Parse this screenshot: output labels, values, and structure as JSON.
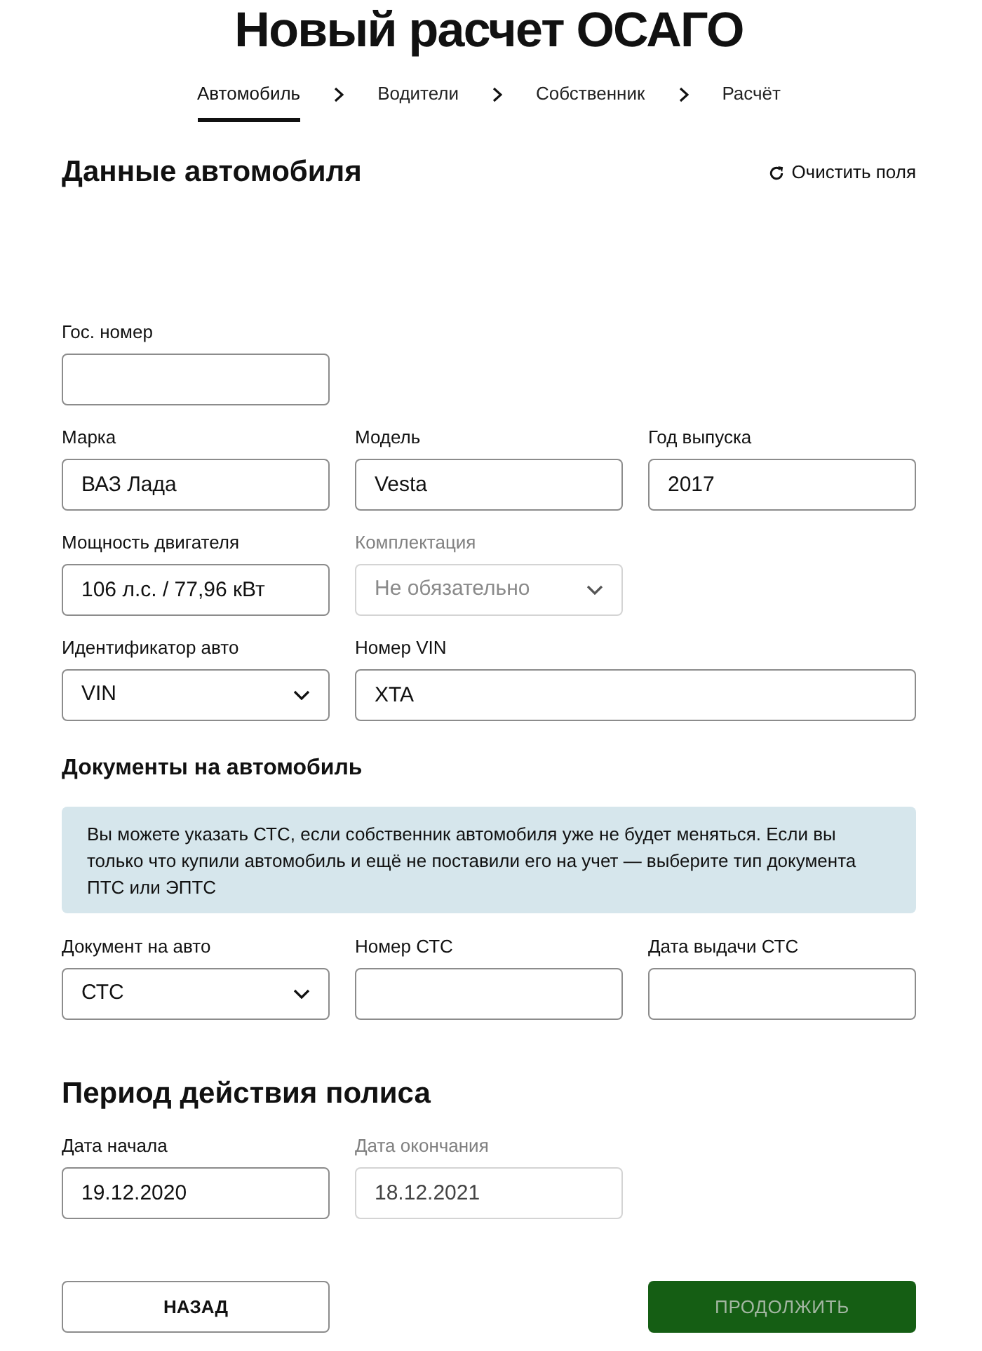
{
  "title": "Новый расчет ОСАГО",
  "steps": [
    {
      "label": "Автомобиль",
      "selected": true
    },
    {
      "label": "Водители",
      "selected": false
    },
    {
      "label": "Собственник",
      "selected": false
    },
    {
      "label": "Расчёт",
      "selected": false
    }
  ],
  "vehicle": {
    "title": "Данные автомобиля",
    "clear_button": "Очистить поля",
    "rows": [
      [
        {
          "label": "Гос. номер",
          "kind": "input",
          "disabled": false
        }
      ],
      [
        {
          "label": "Марка",
          "kind": "input",
          "value": "ВАЗ Лада",
          "disabled": false
        },
        {
          "label": "Модель",
          "kind": "input",
          "value": "Vesta",
          "disabled": false
        },
        {
          "label": "Год выпуска",
          "kind": "input",
          "value": "2017",
          "disabled": false
        }
      ],
      [
        {
          "label": "Мощность двигателя",
          "kind": "input",
          "value": "106 л.с. / 77,96 кВт",
          "disabled": false
        },
        {
          "label": "Комплектация",
          "kind": "select",
          "placeholder": "Не обязательно",
          "disabled": true
        }
      ],
      [
        {
          "label": "Идентификатор авто",
          "kind": "select",
          "value": "VIN",
          "disabled": false
        },
        {
          "label": "Номер VIN",
          "kind": "wide_input",
          "value": "XTA",
          "disabled": false
        }
      ]
    ]
  },
  "documents": {
    "title": "Документы на автомобиль",
    "notice": "Вы можете указать СТС, если собственник автомобиля уже не будет меняться. Если вы только что купили автомобиль и ещё не поставили его на учет — выберите тип документа ПТС или ЭПТС",
    "rows": [
      [
        {
          "label": "Документ на авто",
          "kind": "select",
          "value": "СТС",
          "disabled": false
        },
        {
          "label": "Номер СТС",
          "kind": "input",
          "disabled": false
        },
        {
          "label": "Дата выдачи СТС",
          "kind": "input",
          "disabled": false
        }
      ]
    ]
  },
  "period": {
    "title": "Период действия полиса",
    "rows": [
      [
        {
          "label": "Дата начала",
          "kind": "input",
          "value": "19.12.2020",
          "disabled": false
        },
        {
          "label": "Дата окончания",
          "kind": "input",
          "value": "18.12.2021",
          "disabled": true
        }
      ]
    ]
  },
  "buttons": [
    {
      "label": "НАЗАД",
      "kind": "back",
      "disabled": false
    },
    {
      "label": "ПРОДОЛЖИТЬ",
      "kind": "continue",
      "disabled": true
    }
  ]
}
